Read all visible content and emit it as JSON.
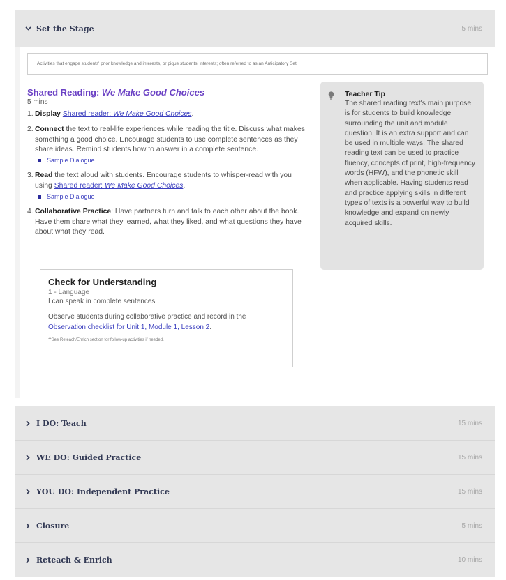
{
  "sections": {
    "set_stage": {
      "title": "Set the Stage",
      "time": "5 mins"
    },
    "others": [
      {
        "title": "I DO: Teach",
        "time": "15 mins"
      },
      {
        "title": "WE DO: Guided Practice",
        "time": "15 mins"
      },
      {
        "title": "YOU DO: Independent Practice",
        "time": "15 mins"
      },
      {
        "title": "Closure",
        "time": "5 mins"
      },
      {
        "title": "Reteach & Enrich",
        "time": "10 mins"
      }
    ]
  },
  "intro": "Activities that engage students' prior knowledge and interests, or pique students' interests; often referred to as an Anticipatory Set.",
  "activity": {
    "title_prefix": "Shared Reading: ",
    "title_book": "We Make Good Choices",
    "duration": "5 mins"
  },
  "steps": {
    "s1": {
      "num": "1.",
      "bold": "Display",
      "link_prefix": "Shared reader: ",
      "link_book": "We Make Good Choices",
      "tail": "."
    },
    "s2": {
      "num": "2.",
      "bold": "Connect",
      "text": " the text to real-life experiences while reading the title. Discuss what makes something a good choice. Encourage students to use complete sentences as they share ideas. Remind students how to answer in a complete sentence.",
      "sample": "Sample Dialogue"
    },
    "s3": {
      "num": "3.",
      "bold": "Read",
      "text": " the text aloud with students. Encourage students to whisper-read with you using ",
      "link_prefix": "Shared reader: ",
      "link_book": "We Make Good Choices",
      "tail": ".",
      "sample": "Sample Dialogue"
    },
    "s4": {
      "num": "4.",
      "bold": "Collaborative Practice",
      "text": ": Have partners turn and talk to each other about the book. Have them share what they learned, what they liked, and what questions they have about what they read."
    }
  },
  "cfu": {
    "title": "Check for Understanding",
    "sub": "1 - Language",
    "goal": "I can speak in complete sentences .",
    "obs_prefix": "Observe students during collaborative practice and record in the ",
    "obs_link": "Observation checklist for Unit 1, Module 1, Lesson 2",
    "obs_tail": ".",
    "note": "**See Reteach/Enrich section for follow-up activities if needed."
  },
  "tip": {
    "title": "Teacher Tip",
    "text": "The shared reading text's main purpose is for students to build knowledge surrounding the unit and module question. It is an extra support and can be used in multiple ways. The shared reading text can be used to practice fluency, concepts of print, high-frequency words (HFW), and the phonetic skill when applicable. Having students read and practice applying skills in different types of texts is a powerful way to build knowledge and expand on newly acquired skills."
  },
  "icons": {
    "expanded": "chevron-down-icon",
    "collapsed": "chevron-right-icon",
    "tip": "lightbulb-icon"
  },
  "colors": {
    "accent": "#6a40c4",
    "link": "#3b3fbf",
    "header_bg": "#e6e6e6"
  }
}
